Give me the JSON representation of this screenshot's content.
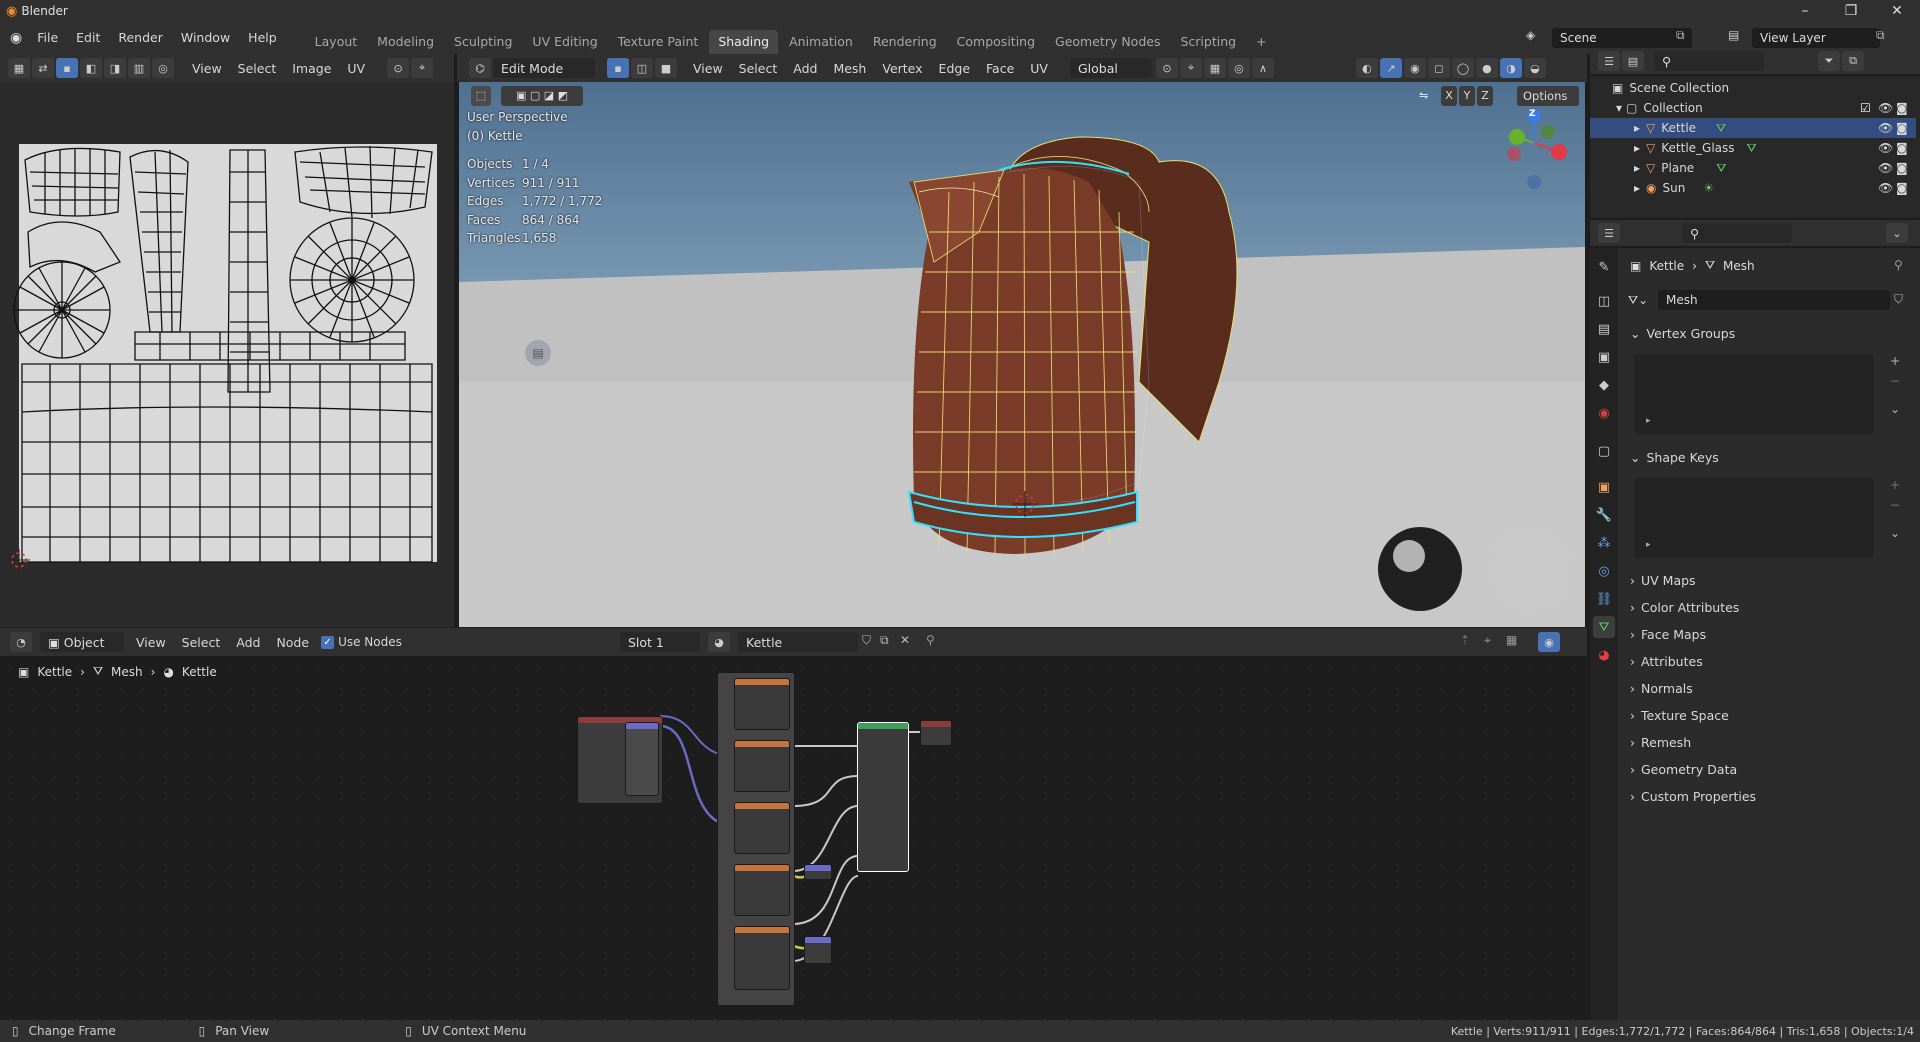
{
  "app": {
    "title": "Blender"
  },
  "menu": [
    "File",
    "Edit",
    "Render",
    "Window",
    "Help"
  ],
  "workspaces": [
    "Layout",
    "Modeling",
    "Sculpting",
    "UV Editing",
    "Texture Paint",
    "Shading",
    "Animation",
    "Rendering",
    "Compositing",
    "Geometry Nodes",
    "Scripting"
  ],
  "active_workspace": "Shading",
  "scene": {
    "name": "Scene",
    "view_layer": "View Layer"
  },
  "uv_editor": {
    "menus": [
      "View",
      "Select",
      "Image",
      "UV"
    ]
  },
  "viewport": {
    "mode": "Edit Mode",
    "menus": [
      "View",
      "Select",
      "Add",
      "Mesh",
      "Vertex",
      "Edge",
      "Face",
      "UV"
    ],
    "orientation": "Global",
    "options_label": "Options",
    "axes": [
      "X",
      "Y",
      "Z"
    ],
    "perspective": "User Perspective",
    "object_label": "(0) Kettle",
    "stats": [
      {
        "k": "Objects",
        "v": "1 / 4"
      },
      {
        "k": "Vertices",
        "v": "911 / 911"
      },
      {
        "k": "Edges",
        "v": "1,772 / 1,772"
      },
      {
        "k": "Faces",
        "v": "864 / 864"
      },
      {
        "k": "Triangles",
        "v": "1,658"
      }
    ],
    "gizmo": {
      "z": "Z"
    }
  },
  "node_editor": {
    "type": "Object",
    "menus": [
      "View",
      "Select",
      "Add",
      "Node"
    ],
    "use_nodes": "Use Nodes",
    "slot": "Slot 1",
    "material": "Kettle",
    "breadcrumb": [
      "Kettle",
      "Mesh",
      "Kettle"
    ]
  },
  "outliner": {
    "root": "Scene Collection",
    "collection": "Collection",
    "items": [
      "Kettle",
      "Kettle_Glass",
      "Plane",
      "Sun"
    ]
  },
  "properties": {
    "breadcrumb": [
      "Kettle",
      "Mesh"
    ],
    "mesh_name": "Mesh",
    "sections": [
      "Vertex Groups",
      "Shape Keys",
      "UV Maps",
      "Color Attributes",
      "Face Maps",
      "Attributes",
      "Normals",
      "Texture Space",
      "Remesh",
      "Geometry Data",
      "Custom Properties"
    ]
  },
  "statusbar": {
    "items": [
      "Change Frame",
      "Pan View",
      "UV Context Menu"
    ],
    "stats": "Kettle | Verts:911/911 | Edges:1,772/1,772 | Faces:864/864 | Tris:1,658 | Objects:1/4"
  },
  "colors": {
    "accent": "#4772b3",
    "kettle": "#7a3b28",
    "bg": "#1d1d1d",
    "panel": "#303030",
    "select_edge": "#f5f08a",
    "seam": "#32e0ff"
  }
}
